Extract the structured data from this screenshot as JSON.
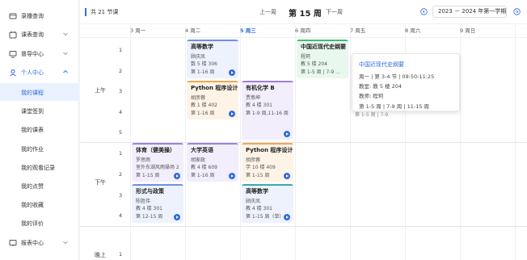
{
  "sidebar": {
    "items": [
      {
        "label": "录播查询",
        "icon": "video-icon"
      },
      {
        "label": "课表查询",
        "icon": "calendar-icon"
      },
      {
        "label": "督导中心",
        "icon": "monitor-icon"
      },
      {
        "label": "个人中心",
        "icon": "user-icon"
      },
      {
        "label": "报表中心",
        "icon": "chart-icon"
      }
    ],
    "sub_items": [
      "我的课程",
      "课堂签到",
      "我的课表",
      "我的作业",
      "我的观看记录",
      "我的点赞",
      "我的收藏",
      "我的评价"
    ]
  },
  "topbar": {
    "total": "共 21 节课",
    "prev": "上一周",
    "current": "第 15 周",
    "next": "下一周",
    "term": "2023 － 2024 年第一学期"
  },
  "days": [
    "3 周一",
    "4 周二",
    "5 周三",
    "6 周四",
    "7 周五",
    "8 周六",
    "9 周日"
  ],
  "periods": {
    "morning": "上午",
    "afternoon": "下午",
    "evening": "晚上"
  },
  "slots": [
    "1",
    "2",
    "3",
    "4",
    "5",
    "1",
    "2",
    "3",
    "4",
    "1"
  ],
  "courses": [
    {
      "title": "高等数学",
      "teacher": "顾庆凤",
      "room": "数 5 楼 306",
      "weeks": "第 1-16 周"
    },
    {
      "title": "Python 程序设计",
      "teacher": "胡彦蓉",
      "room": "教 1 楼 402",
      "weeks": "第 1-16 周"
    },
    {
      "title": "有机化学 B",
      "teacher": "贾燕坤",
      "room": "教 4 楼 301",
      "weeks": "第 1-9 周,11-16 周"
    },
    {
      "title": "中国近现代史纲要",
      "teacher": "程珂",
      "room": "教 5 楼 204",
      "weeks": "第 1-5 周 | 7-9 ..."
    },
    {
      "title": "体育（健美操）",
      "teacher": "罗思雨",
      "room": "室外东湖风雨操场 2",
      "weeks": "第 1-15 周"
    },
    {
      "title": "大学英语",
      "teacher": "胡家政",
      "room": "教 4 楼 609",
      "weeks": "第 1-16 周"
    },
    {
      "title": "Python 程序设计",
      "teacher": "胡彦蓉",
      "room": "学 10 楼 409",
      "weeks": "第 1-15 周"
    },
    {
      "title": "形式与政策",
      "teacher": "陈胜伟",
      "room": "教 4 楼 301",
      "weeks": "第 12-15 周"
    },
    {
      "title": "高等数学",
      "teacher": "顾庆凤",
      "room": "教 4 楼 301",
      "weeks": "第 1-15 周（单）"
    }
  ],
  "popup": {
    "title": "中国近现代史纲要",
    "time": "周一 | 第 3-4 节 | 09:50-11:25",
    "room": "教室: 教 5 楼 204",
    "teacher": "教师: 程珂",
    "weeks": "第 1-5 周 | 7-9 周 | 11-15 周"
  },
  "behind_popup_text": "第 1-5 周 | 7-9",
  "colors": {
    "accent": "#2f6bde",
    "course_blue": "#eef2fd",
    "bar_blue": "#6f8fe6",
    "bar_orange": "#f3a64a",
    "bar_purple": "#a07de0",
    "bar_green": "#3fbf74",
    "bar_teal": "#3aa9b0",
    "bg_orange": "#fdf3e7",
    "bg_purple": "#f3eefc",
    "bg_green": "#e9f8ef"
  }
}
